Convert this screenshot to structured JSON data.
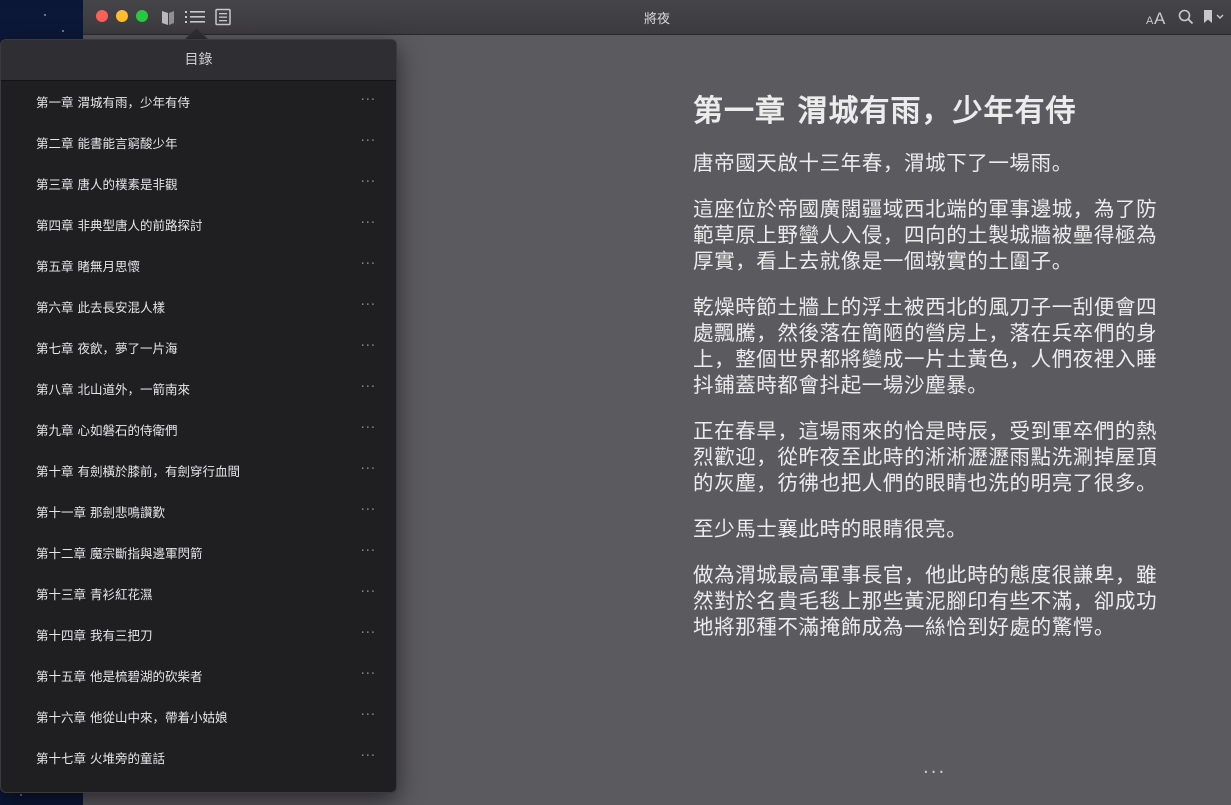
{
  "window": {
    "title": "將夜"
  },
  "toolbar": {
    "left_icons": [
      "library-icon",
      "list-icon",
      "notes-icon"
    ],
    "right_icons": [
      "font-size-icon",
      "search-icon",
      "bookmark-icon"
    ]
  },
  "toc": {
    "header": "目錄",
    "items": [
      {
        "label": "第一章 渭城有雨，少年有侍",
        "more": "···"
      },
      {
        "label": "第二章 能書能言窮酸少年",
        "more": "···"
      },
      {
        "label": "第三章 唐人的樸素是非觀",
        "more": "···"
      },
      {
        "label": "第四章 非典型唐人的前路探討",
        "more": "···"
      },
      {
        "label": "第五章 睹無月思懷",
        "more": "···"
      },
      {
        "label": "第六章 此去長安混人樣",
        "more": "···"
      },
      {
        "label": "第七章 夜飲，夢了一片海",
        "more": "···"
      },
      {
        "label": "第八章 北山道外，一箭南來",
        "more": "···"
      },
      {
        "label": "第九章 心如磐石的侍衛們",
        "more": "···"
      },
      {
        "label": "第十章 有劍橫於膝前，有劍穿行血間",
        "more": "···"
      },
      {
        "label": "第十一章 那劍悲鳴讚歎",
        "more": "···"
      },
      {
        "label": "第十二章 魔宗斷指與邊軍閃箭",
        "more": "···"
      },
      {
        "label": "第十三章 青衫紅花濕",
        "more": "···"
      },
      {
        "label": "第十四章 我有三把刀",
        "more": "···"
      },
      {
        "label": "第十五章 他是梳碧湖的砍柴者",
        "more": "···"
      },
      {
        "label": "第十六章 他從山中來，帶着小姑娘",
        "more": "···"
      },
      {
        "label": "第十七章 火堆旁的童話",
        "more": "···"
      }
    ]
  },
  "reader": {
    "chapter_title": "第一章 渭城有雨，少年有侍",
    "paragraphs": [
      "唐帝國天啟十三年春，渭城下了一場雨。",
      "這座位於帝國廣闊疆域西北端的軍事邊城，為了防範草原上野蠻人入侵，四向的土製城牆被壘得極為厚實，看上去就像是一個墩實的土圍子。",
      "乾燥時節土牆上的浮土被西北的風刀子一刮便會四處飄騰，然後落在簡陋的營房上，落在兵卒們的身上，整個世界都將變成一片土黃色，人們夜裡入睡抖鋪蓋時都會抖起一場沙塵暴。",
      "正在春旱，這場雨來的恰是時辰，受到軍卒們的熱烈歡迎，從昨夜至此時的淅淅瀝瀝雨點洗涮掉屋頂的灰塵，彷彿也把人們的眼睛也洗的明亮了很多。",
      "至少馬士襄此時的眼睛很亮。",
      "做為渭城最高軍事長官，他此時的態度很謙卑，雖然對於名貴毛毯上那些黃泥腳印有些不滿，卻成功地將那種不滿掩飾成為一絲恰到好處的驚愕。"
    ],
    "more": "···"
  }
}
